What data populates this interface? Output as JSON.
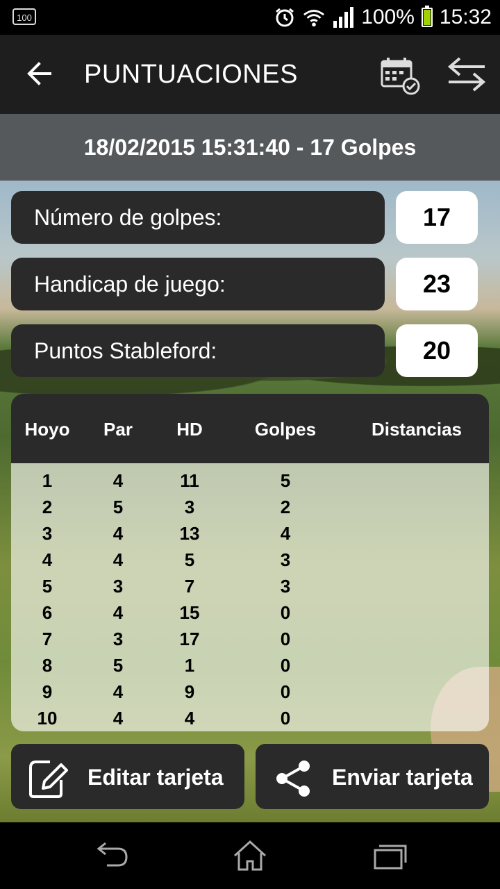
{
  "status_bar": {
    "left_badge": "100",
    "battery_percent_text": "100%",
    "time": "15:32",
    "icons": [
      "alarm-icon",
      "wifi-icon",
      "signal-icon",
      "battery-icon"
    ]
  },
  "app_bar": {
    "title": "PUNTUACIONES",
    "back_icon": "arrow-left-icon",
    "calendar_icon": "calendar-check-icon",
    "swap_icon": "swap-arrows-icon"
  },
  "subheader": {
    "text": "18/02/2015 15:31:40 - 17 Golpes"
  },
  "stats": [
    {
      "label": "Número de golpes:",
      "value": "17"
    },
    {
      "label": "Handicap de juego:",
      "value": "23"
    },
    {
      "label": "Puntos Stableford:",
      "value": "20"
    }
  ],
  "table": {
    "headers": [
      "Hoyo",
      "Par",
      "HD",
      "Golpes",
      "Distancias"
    ],
    "rows": [
      [
        "1",
        "4",
        "11",
        "5",
        ""
      ],
      [
        "2",
        "5",
        "3",
        "2",
        ""
      ],
      [
        "3",
        "4",
        "13",
        "4",
        ""
      ],
      [
        "4",
        "4",
        "5",
        "3",
        ""
      ],
      [
        "5",
        "3",
        "7",
        "3",
        ""
      ],
      [
        "6",
        "4",
        "15",
        "0",
        ""
      ],
      [
        "7",
        "3",
        "17",
        "0",
        ""
      ],
      [
        "8",
        "5",
        "1",
        "0",
        ""
      ],
      [
        "9",
        "4",
        "9",
        "0",
        ""
      ],
      [
        "10",
        "4",
        "4",
        "0",
        ""
      ]
    ]
  },
  "actions": {
    "edit_label": "Editar tarjeta",
    "edit_icon": "edit-note-icon",
    "send_label": "Enviar tarjeta",
    "send_icon": "share-icon"
  },
  "nav_bar": {
    "icons": [
      "back-nav-icon",
      "home-nav-icon",
      "recents-nav-icon"
    ]
  },
  "colors": {
    "app_bar_bg": "#1e1e1e",
    "subheader_bg": "#56595c",
    "card_dark": "#2a2a2a",
    "battery_green": "#9fd200"
  }
}
